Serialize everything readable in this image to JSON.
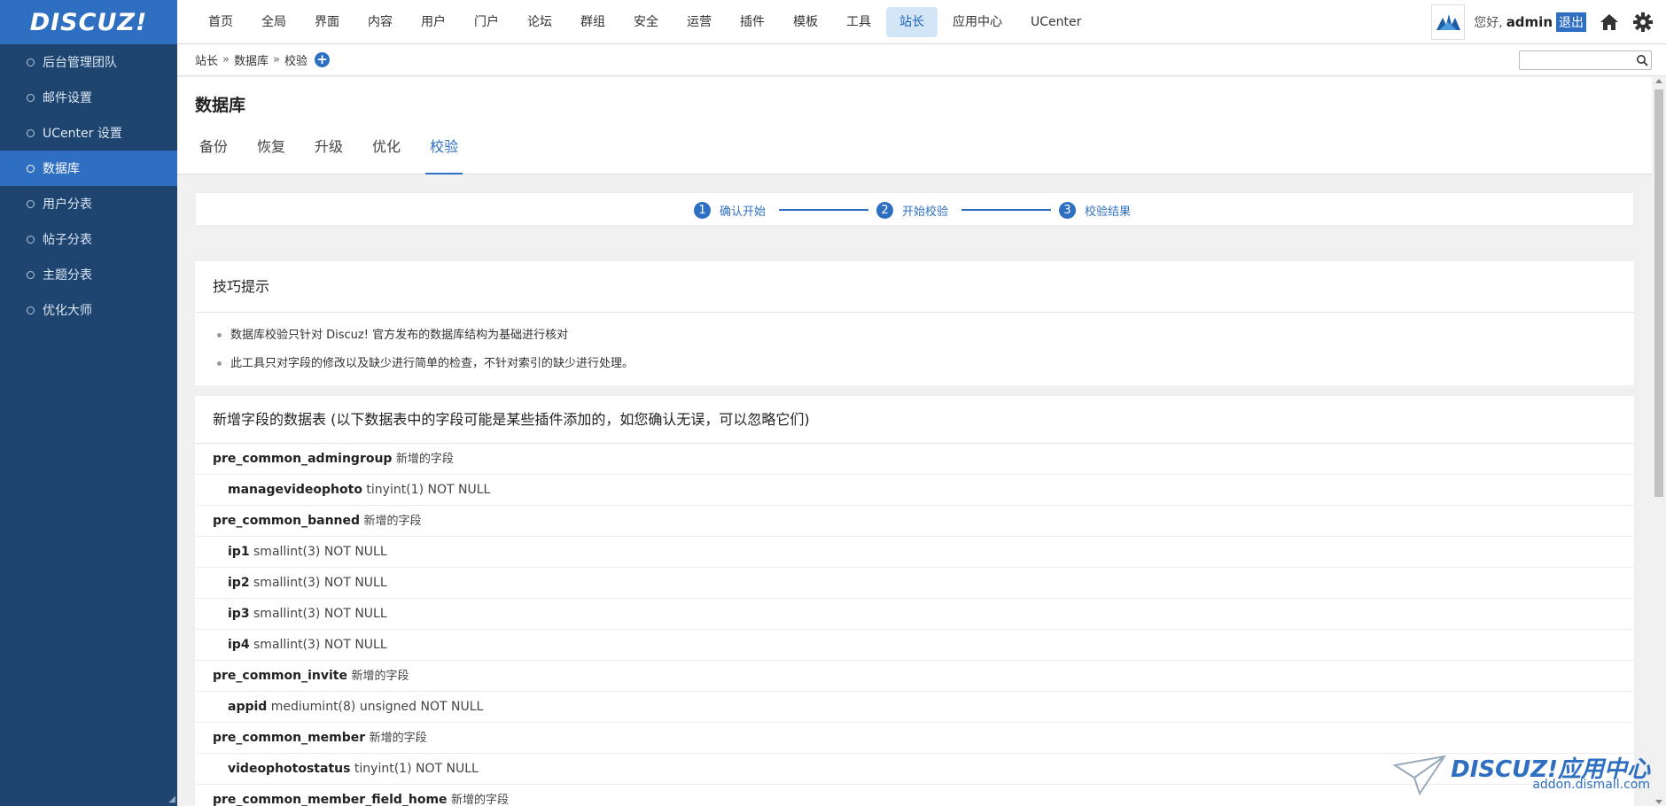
{
  "logo": "DISCUZ!",
  "nav": [
    "首页",
    "全局",
    "界面",
    "内容",
    "用户",
    "门户",
    "论坛",
    "群组",
    "安全",
    "运营",
    "插件",
    "模板",
    "工具",
    "站长",
    "应用中心",
    "UCenter"
  ],
  "nav_active_index": 13,
  "user": {
    "greeting": "您好,",
    "name": "admin",
    "logout": "退出"
  },
  "sidebar": [
    "后台管理团队",
    "邮件设置",
    "UCenter 设置",
    "数据库",
    "用户分表",
    "帖子分表",
    "主题分表",
    "优化大师"
  ],
  "sidebar_active_index": 3,
  "breadcrumb": [
    "站长",
    "数据库",
    "校验"
  ],
  "breadcrumb_sep": "»",
  "page_title": "数据库",
  "tabs": [
    "备份",
    "恢复",
    "升级",
    "优化",
    "校验"
  ],
  "tab_active_index": 4,
  "steps": [
    {
      "num": "1",
      "label": "确认开始"
    },
    {
      "num": "2",
      "label": "开始校验"
    },
    {
      "num": "3",
      "label": "校验结果"
    }
  ],
  "tips": {
    "title": "技巧提示",
    "items": [
      "数据库校验只针对 Discuz! 官方发布的数据库结构为基础进行核对",
      "此工具只对字段的修改以及缺少进行简单的检查，不针对索引的缺少进行处理。"
    ]
  },
  "fields": {
    "title": "新增字段的数据表 (以下数据表中的字段可能是某些插件添加的，如您确认无误，可以忽略它们)",
    "rows": [
      {
        "kind": "table",
        "name": "pre_common_admingroup",
        "desc": "新增的字段"
      },
      {
        "kind": "field",
        "name": "managevideophoto",
        "desc": "tinyint(1) NOT NULL"
      },
      {
        "kind": "table",
        "name": "pre_common_banned",
        "desc": "新增的字段"
      },
      {
        "kind": "field",
        "name": "ip1",
        "desc": "smallint(3) NOT NULL"
      },
      {
        "kind": "field",
        "name": "ip2",
        "desc": "smallint(3) NOT NULL"
      },
      {
        "kind": "field",
        "name": "ip3",
        "desc": "smallint(3) NOT NULL"
      },
      {
        "kind": "field",
        "name": "ip4",
        "desc": "smallint(3) NOT NULL"
      },
      {
        "kind": "table",
        "name": "pre_common_invite",
        "desc": "新增的字段"
      },
      {
        "kind": "field",
        "name": "appid",
        "desc": "mediumint(8) unsigned NOT NULL"
      },
      {
        "kind": "table",
        "name": "pre_common_member",
        "desc": "新增的字段"
      },
      {
        "kind": "field",
        "name": "videophotostatus",
        "desc": "tinyint(1) NOT NULL"
      },
      {
        "kind": "table",
        "name": "pre_common_member_field_home",
        "desc": "新增的字段"
      }
    ]
  },
  "watermark": {
    "title": "DISCUZ!应用中心",
    "url": "addon.dismall.com"
  },
  "colors": {
    "accent": "#2f6fc2",
    "sidebar": "#1e4470",
    "nav_active_bg": "#d3e6f7"
  }
}
